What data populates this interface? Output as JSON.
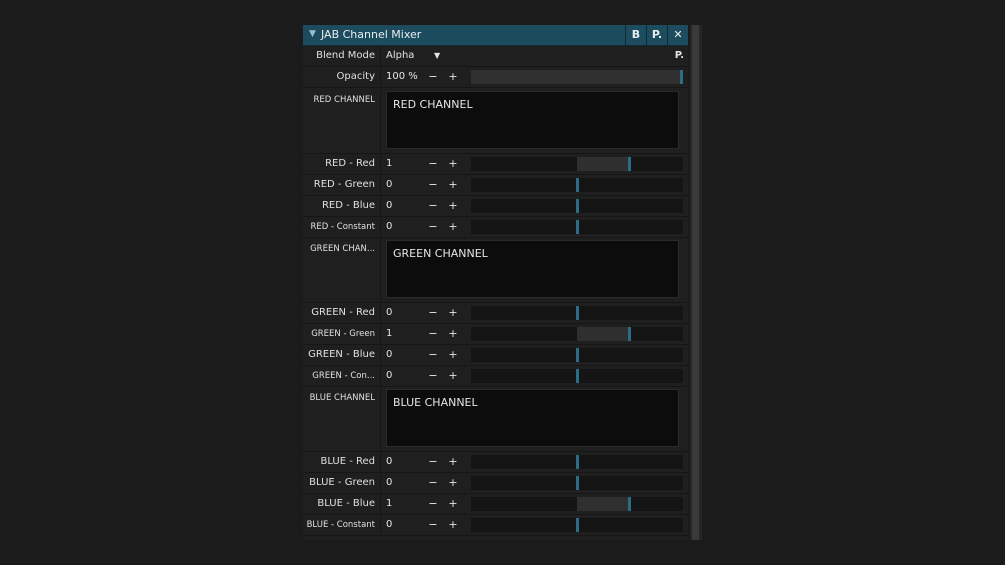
{
  "window": {
    "title": "JAB Channel Mixer",
    "buttons": [
      "B",
      "P.",
      "✕"
    ]
  },
  "blend": {
    "label": "Blend Mode",
    "value": "Alpha",
    "preset_button": "P."
  },
  "opacity": {
    "label": "Opacity",
    "value": "100 %",
    "level": 1.0
  },
  "controls": {
    "minus": "−",
    "plus": "+"
  },
  "sections": [
    {
      "label": "RED CHANNEL",
      "text": "RED CHANNEL",
      "sliders": [
        {
          "label": "RED - Red",
          "value": "1"
        },
        {
          "label": "RED - Green",
          "value": "0"
        },
        {
          "label": "RED - Blue",
          "value": "0"
        },
        {
          "label": "RED - Constant",
          "value": "0"
        }
      ]
    },
    {
      "label": "GREEN CHAN...",
      "text": "GREEN CHANNEL",
      "sliders": [
        {
          "label": "GREEN - Red",
          "value": "0"
        },
        {
          "label": "GREEN - Green",
          "value": "1"
        },
        {
          "label": "GREEN - Blue",
          "value": "0"
        },
        {
          "label": "GREEN - Con...",
          "value": "0"
        }
      ]
    },
    {
      "label": "BLUE CHANNEL",
      "text": "BLUE CHANNEL",
      "sliders": [
        {
          "label": "BLUE - Red",
          "value": "0"
        },
        {
          "label": "BLUE - Green",
          "value": "0"
        },
        {
          "label": "BLUE - Blue",
          "value": "1"
        },
        {
          "label": "BLUE - Constant",
          "value": "0"
        }
      ]
    }
  ],
  "colors": {
    "title_bar": "#1c4c5e",
    "accent": "#2c6c84",
    "background": "#1f1f1f"
  }
}
